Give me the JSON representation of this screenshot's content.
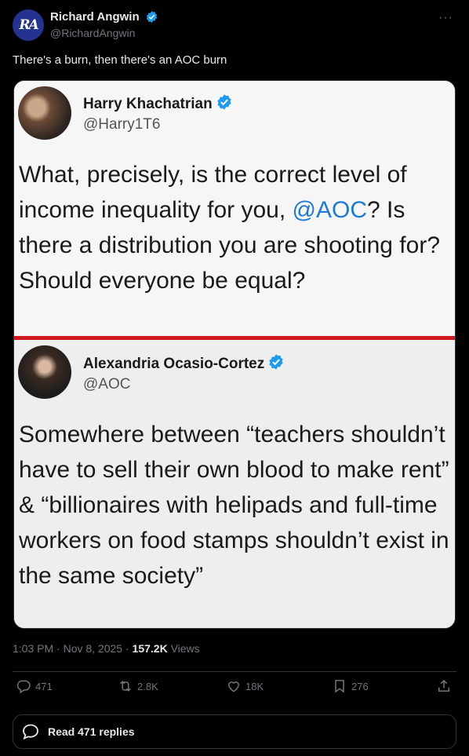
{
  "author": {
    "display_name": "Richard Angwin",
    "handle": "@RichardAngwin",
    "avatar_icon": "ra-monogram-avatar",
    "avatar_text": "RA",
    "verified": true,
    "more_icon": "more-icon",
    "more_label": "···"
  },
  "tweet": {
    "text": "There's a burn, then there's an AOC burn"
  },
  "media": {
    "quote1": {
      "name": "Harry Khachatrian",
      "handle": "@Harry1T6",
      "text_before": "What, precisely, is the correct level of income inequality for you, ",
      "mention": "@AOC",
      "text_after": "? Is there a distribution you are shooting for? Should everyone be equal?"
    },
    "quote2": {
      "name": "Alexandria Ocasio-Cortez",
      "handle": "@AOC",
      "text": "Somewhere between “teachers shouldn’t have to sell their own blood to make rent” & “billionaires with helipads and full-time workers on food stamps shouldn’t exist in the same society”"
    },
    "divider_color": "#d11a1f"
  },
  "meta": {
    "time_date": "1:03 PM · Nov 8, 2025 · ",
    "views_count": "157.2K",
    "views_label": " Views"
  },
  "actions": {
    "replies": "471",
    "reposts": "2.8K",
    "likes": "18K",
    "bookmarks": "276"
  },
  "read_replies": {
    "label": "Read 471 replies",
    "icon": "speech-bubble-icon"
  },
  "colors": {
    "accent": "#1d9bf0",
    "background": "#000000",
    "muted": "#71767b"
  }
}
